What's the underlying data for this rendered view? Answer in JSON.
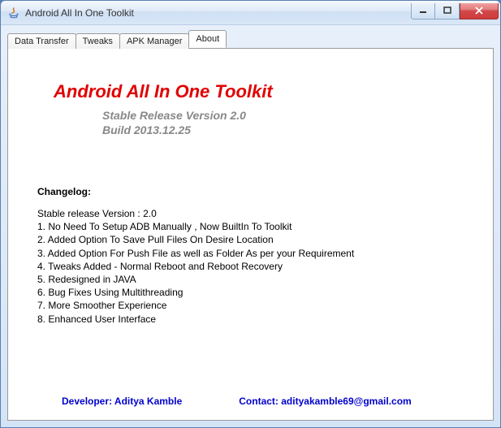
{
  "window": {
    "title": "Android All In One Toolkit"
  },
  "tabs": [
    {
      "label": "Data Transfer"
    },
    {
      "label": "Tweaks"
    },
    {
      "label": "APK Manager"
    },
    {
      "label": "About"
    }
  ],
  "about": {
    "title": "Android All In One Toolkit",
    "version_line1": "Stable Release Version 2.0",
    "version_line2": "Build 2013.12.25",
    "changelog_heading": "Changelog:",
    "changelog_body": "Stable release Version : 2.0\n1. No Need To Setup ADB Manually , Now BuiltIn To Toolkit\n2. Added Option To Save Pull Files On Desire Location\n3. Added Option For Push File as well as Folder As per your Requirement\n4. Tweaks Added - Normal Reboot and Reboot Recovery\n5. Redesigned in JAVA\n6. Bug Fixes Using Multithreading\n7. More Smoother Experience\n8. Enhanced User Interface",
    "developer": "Developer: Aditya Kamble",
    "contact": "Contact: adityakamble69@gmail.com"
  }
}
